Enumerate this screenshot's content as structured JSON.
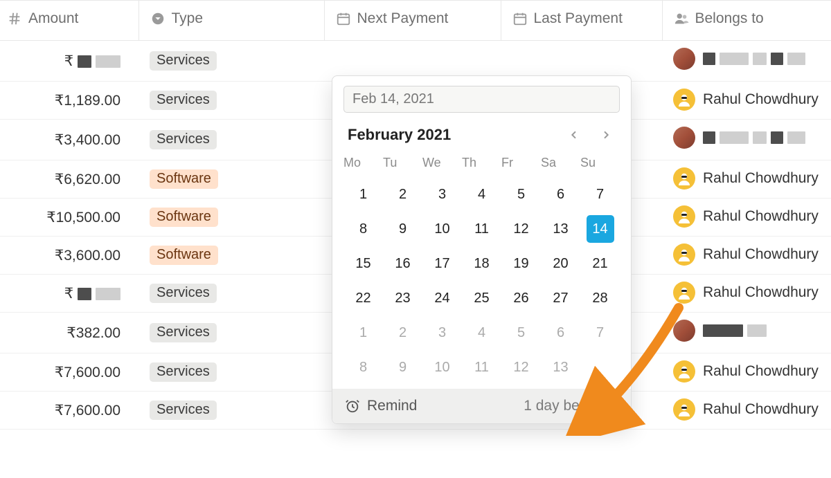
{
  "columns": {
    "amount": "Amount",
    "type": "Type",
    "next_payment": "Next Payment",
    "last_payment": "Last Payment",
    "belongs_to": "Belongs to"
  },
  "type_labels": {
    "services": "Services",
    "software": "Software"
  },
  "rows": [
    {
      "amount_prefix": "₹",
      "amount": "",
      "masked_amount": true,
      "type": "services",
      "user": "masked",
      "avatar": "photo"
    },
    {
      "amount": "₹1,189.00",
      "type": "services",
      "user": "Rahul Chowdhury",
      "avatar": "rahul"
    },
    {
      "amount": "₹3,400.00",
      "type": "services",
      "user": "masked",
      "avatar": "photo"
    },
    {
      "amount": "₹6,620.00",
      "type": "software",
      "user": "Rahul Chowdhury",
      "avatar": "rahul"
    },
    {
      "amount": "₹10,500.00",
      "type": "software",
      "user": "Rahul Chowdhury",
      "avatar": "rahul"
    },
    {
      "amount": "₹3,600.00",
      "type": "software",
      "user": "Rahul Chowdhury",
      "avatar": "rahul"
    },
    {
      "amount_prefix": "₹",
      "amount": "",
      "masked_amount": true,
      "type": "services",
      "user": "Rahul Chowdhury",
      "avatar": "rahul"
    },
    {
      "amount": "₹382.00",
      "type": "services",
      "user": "masked2",
      "avatar": "photo"
    },
    {
      "amount": "₹7,600.00",
      "type": "services",
      "user": "Rahul Chowdhury",
      "avatar": "rahul"
    },
    {
      "amount": "₹7,600.00",
      "type": "services",
      "user": "Rahul Chowdhury",
      "avatar": "rahul"
    }
  ],
  "picker": {
    "input_value": "Feb 14, 2021",
    "month_title": "February 2021",
    "weekdays": [
      "Mo",
      "Tu",
      "We",
      "Th",
      "Fr",
      "Sa",
      "Su"
    ],
    "weeks": [
      [
        {
          "d": "1"
        },
        {
          "d": "2"
        },
        {
          "d": "3"
        },
        {
          "d": "4"
        },
        {
          "d": "5"
        },
        {
          "d": "6"
        },
        {
          "d": "7"
        }
      ],
      [
        {
          "d": "8"
        },
        {
          "d": "9"
        },
        {
          "d": "10"
        },
        {
          "d": "11"
        },
        {
          "d": "12"
        },
        {
          "d": "13"
        },
        {
          "d": "14",
          "sel": true
        }
      ],
      [
        {
          "d": "15"
        },
        {
          "d": "16"
        },
        {
          "d": "17"
        },
        {
          "d": "18"
        },
        {
          "d": "19"
        },
        {
          "d": "20"
        },
        {
          "d": "21"
        }
      ],
      [
        {
          "d": "22"
        },
        {
          "d": "23"
        },
        {
          "d": "24"
        },
        {
          "d": "25"
        },
        {
          "d": "26"
        },
        {
          "d": "27"
        },
        {
          "d": "28"
        }
      ],
      [
        {
          "d": "1",
          "out": true
        },
        {
          "d": "2",
          "out": true
        },
        {
          "d": "3",
          "out": true
        },
        {
          "d": "4",
          "out": true
        },
        {
          "d": "5",
          "out": true
        },
        {
          "d": "6",
          "out": true
        },
        {
          "d": "7",
          "out": true
        }
      ],
      [
        {
          "d": "8",
          "out": true
        },
        {
          "d": "9",
          "out": true
        },
        {
          "d": "10",
          "out": true
        },
        {
          "d": "11",
          "out": true
        },
        {
          "d": "12",
          "out": true
        },
        {
          "d": "13",
          "out": true
        },
        {
          "d": ""
        }
      ]
    ],
    "remind_label": "Remind",
    "remind_value": "1 day before"
  },
  "colors": {
    "accent": "#1aa7e0",
    "arrow": "#f08a1d"
  }
}
